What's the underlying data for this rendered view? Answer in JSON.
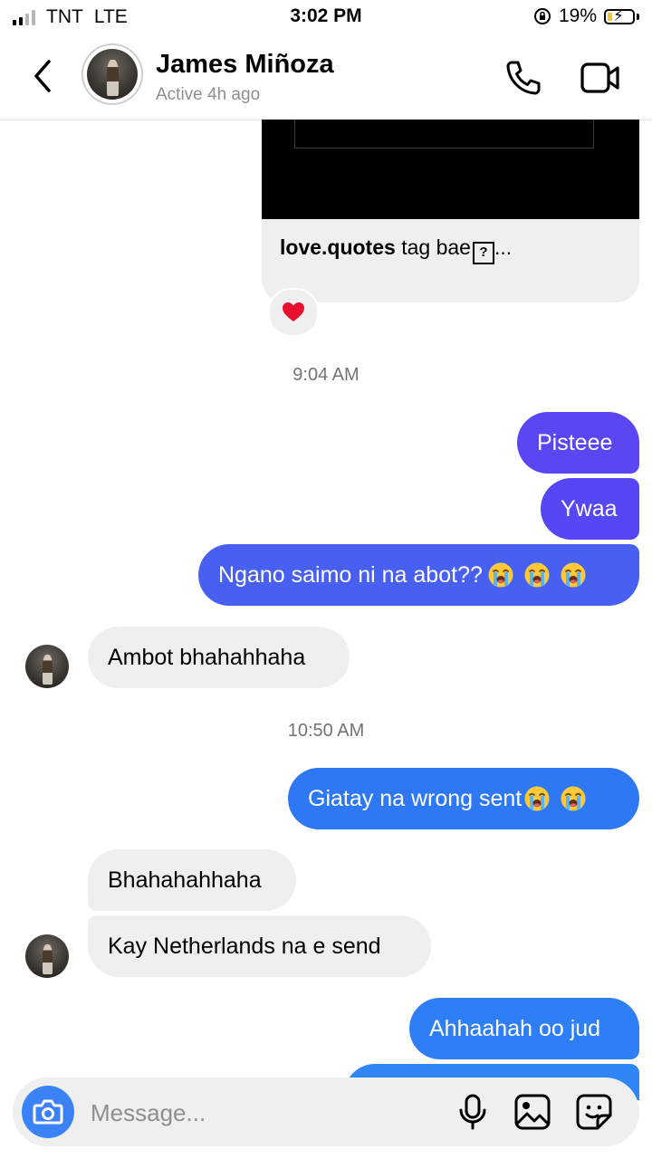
{
  "status_bar": {
    "carrier": "TNT",
    "network": "LTE",
    "time": "3:02 PM",
    "battery": "19%",
    "battery_level": 0.19
  },
  "header": {
    "name": "James Miñoza",
    "status": "Active 4h ago"
  },
  "shared_post": {
    "username": "love.quotes",
    "caption": "tag bae",
    "ellipsis": "...",
    "reaction": "heart"
  },
  "timestamps": [
    "9:04 AM",
    "10:50 AM"
  ],
  "messages": [
    {
      "text": "Pisteee",
      "sender": "me"
    },
    {
      "text": "Ywaa",
      "sender": "me"
    },
    {
      "text": "Ngano saimo ni na abot??",
      "sender": "me",
      "emoji_count": 3
    },
    {
      "text": "Ambot bhahahhaha",
      "sender": "them"
    },
    {
      "text": "Giatay na wrong sent",
      "sender": "me",
      "emoji_count": 2
    },
    {
      "text": "Bhahahahhaha",
      "sender": "them"
    },
    {
      "text": "Kay Netherlands na e send",
      "sender": "them"
    },
    {
      "text": "Ahhaahah oo jud",
      "sender": "me"
    }
  ],
  "composer": {
    "placeholder": "Message..."
  },
  "icons": {
    "back": "chevron-left-icon",
    "call": "phone-icon",
    "video": "video-camera-icon",
    "camera": "camera-icon",
    "mic": "microphone-icon",
    "gallery": "image-icon",
    "sticker": "sticker-icon",
    "emoji": "loudly-crying-face"
  },
  "colors": {
    "bubble_purple": "#5a46f2",
    "bubble_indigo": "#4760f2",
    "bubble_blue": "#2e78f5",
    "camera_blue": "#3b82f6",
    "incoming": "#efefef"
  }
}
